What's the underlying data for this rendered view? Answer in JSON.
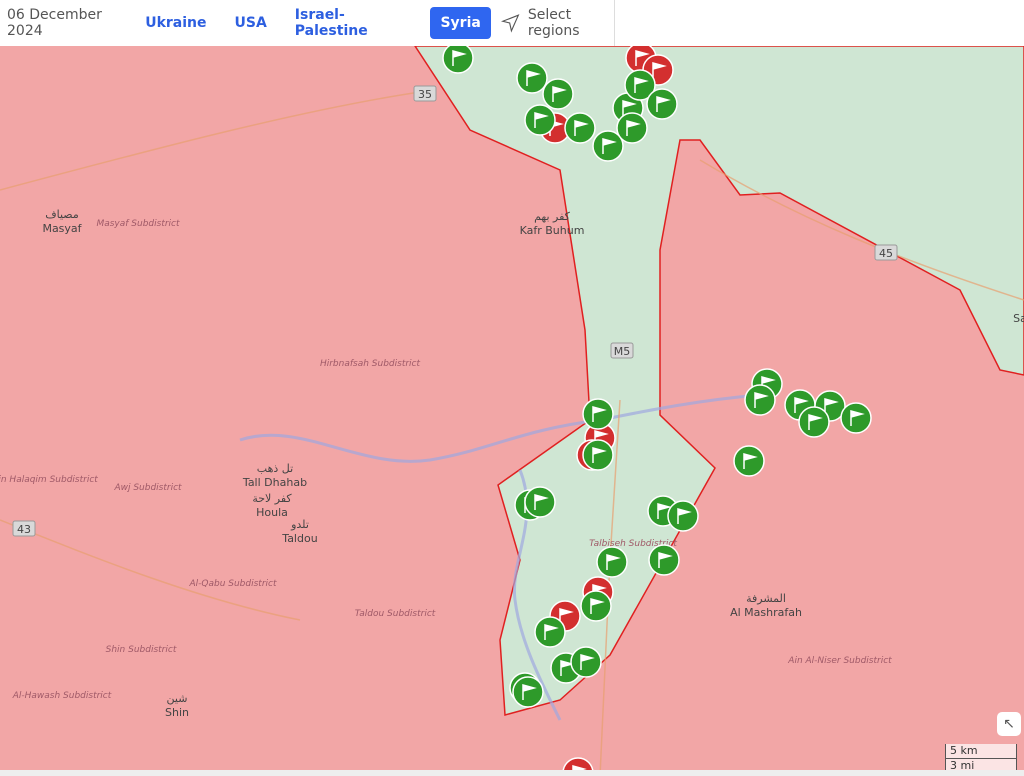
{
  "header": {
    "date": "06 December 2024",
    "tabs": [
      "Ukraine",
      "USA",
      "Israel-Palestine",
      "Syria"
    ],
    "active_tab": "Syria",
    "select_regions": "Select regions",
    "select_icon": "navigation-arrow-icon"
  },
  "colors": {
    "opposition": "#f2a6a6",
    "government_controlled": "#cfe6d3",
    "frontline": "#e02020",
    "marker_green": "#2e9a2a",
    "marker_red": "#d32f2f",
    "accent": "#2f66f0"
  },
  "map": {
    "places": [
      {
        "ar": "مصياف",
        "en": "Masyaf"
      },
      {
        "ar": "كفر بهم",
        "en": "Kafr Buhum"
      },
      {
        "ar": "تل ذهب",
        "en": "Tall Dhahab"
      },
      {
        "ar": "كفر لاحة",
        "en": "Houla"
      },
      {
        "ar": "تلدو",
        "en": "Taldou"
      },
      {
        "ar": "شين",
        "en": "Shin"
      },
      {
        "ar": "المشرفة",
        "en": "Al Mashrafah"
      }
    ],
    "subdistricts": [
      "Masyaf Subdistrict",
      "Hirbnafsah Subdistrict",
      "Ain Halaqim Subdistrict",
      "Awj Subdistrict",
      "Al-Qabu Subdistrict",
      "Taldou Subdistrict",
      "Shin Subdistrict",
      "Al-Hawash Subdistrict",
      "Talbiseh Subdistrict",
      "Ain Al-Niser Subdistrict"
    ],
    "roads": [
      "35",
      "45",
      "43",
      "M5"
    ],
    "edge_label": "Sa"
  },
  "scale": {
    "km": "5 km",
    "mi": "3 mi"
  },
  "home_icon": "arrow-up-left-icon"
}
